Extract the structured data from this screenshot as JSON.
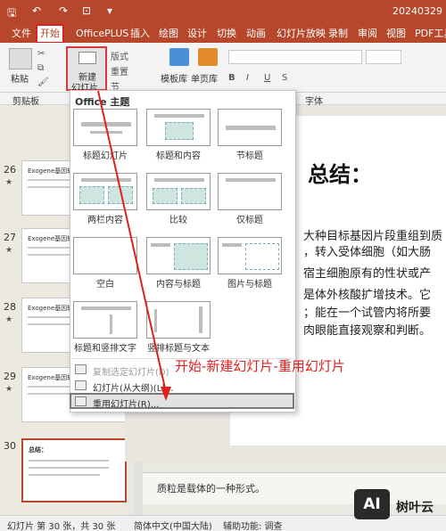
{
  "titlebar": {
    "doc_name": "20240329",
    "qa_save": "🖫",
    "qa_undo": "↶",
    "qa_redo": "↷"
  },
  "tabs": [
    "文件",
    "开始",
    "OfficePLUS",
    "插入",
    "绘图",
    "设计",
    "切换",
    "动画",
    "幻灯片放映",
    "录制",
    "审阅",
    "视图",
    "PDF工具"
  ],
  "ribbon": {
    "paste": "粘贴",
    "new_slide_line1": "新建",
    "new_slide_line2": "幻灯片",
    "layout": "版式",
    "reset": "重置",
    "section": "节",
    "template_lib": "模板库",
    "single_page_lib": "单页库",
    "groups": {
      "clipboard": "剪贴板",
      "font": "字体"
    }
  },
  "colors": {
    "accent": "#b7472a",
    "highlight": "#e0201d"
  },
  "gallery": {
    "header": "Office 主题",
    "layouts": [
      "标题幻灯片",
      "标题和内容",
      "节标题",
      "两栏内容",
      "比较",
      "仅标题",
      "空白",
      "内容与标题",
      "图片与标题",
      "标题和竖排文字",
      "竖排标题与文本"
    ],
    "items": [
      "复制选定幻灯片(D)",
      "幻灯片(从大纲)(L)...",
      "重用幻灯片(R)..."
    ]
  },
  "thumbnails": {
    "numbers": [
      "26",
      "27",
      "28",
      "29",
      "30"
    ],
    "star": "★",
    "heading": "Exogene基因转移",
    "last_heading": "总结："
  },
  "slide": {
    "title": "总结：",
    "lines": [
      "大种目标基因片段重组到质",
      "，转入受体细胞（如大肠",
      "宿主细胞原有的性状或产",
      "是体外核酸扩增技术。它",
      "；能在一个试管内将所要",
      "肉眼能直接观察和判断。"
    ]
  },
  "notes": "质粒是载体的一种形式。",
  "annotation": "开始-新建幻灯片-重用幻灯片",
  "status": {
    "slide_count": "幻灯片 第 30 张，共 30 张",
    "language": "简体中文(中国大陆)",
    "accessibility": "辅助功能: 调查"
  },
  "watermark": {
    "logo": "AI",
    "text": "树叶云"
  }
}
